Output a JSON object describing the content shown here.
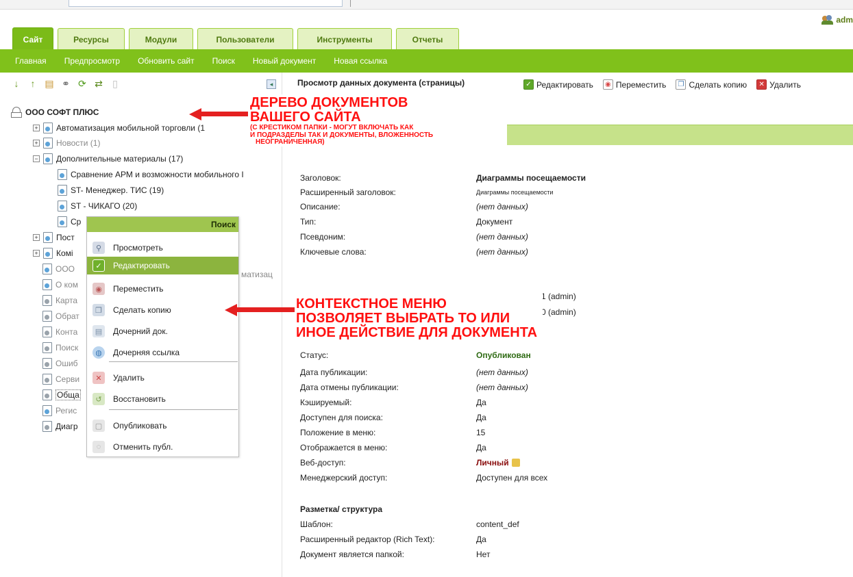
{
  "header": {
    "user_name": "adm"
  },
  "tabs": [
    {
      "label": "Сайт",
      "active": true
    },
    {
      "label": "Ресурсы",
      "active": false
    },
    {
      "label": "Модули",
      "active": false
    },
    {
      "label": "Пользователи",
      "active": false
    },
    {
      "label": "Инструменты",
      "active": false
    },
    {
      "label": "Отчеты",
      "active": false
    }
  ],
  "subnav": [
    "Главная",
    "Предпросмотр",
    "Обновить сайт",
    "Поиск",
    "Новый документ",
    "Новая ссылка"
  ],
  "tree": {
    "root": "ООО СОФТ ПЛЮС",
    "items": [
      {
        "label": "Автоматизация мобильной торговли (1",
        "toggle": "+"
      },
      {
        "label": "Новости (1)",
        "toggle": "+"
      },
      {
        "label": "Дополнительные материалы (17)",
        "toggle": "−"
      },
      {
        "label": "Сравнение АРМ и возможности мобильного I"
      },
      {
        "label": "ST- Менеджер. ТИС (19)"
      },
      {
        "label": "ST - ЧИКАГО (20)"
      },
      {
        "label": "Ср"
      },
      {
        "label": "Пост",
        "toggle": "+"
      },
      {
        "label": "Комі",
        "toggle": "+"
      },
      {
        "label": "ООО"
      },
      {
        "label": "О ком"
      },
      {
        "label": "Карта"
      },
      {
        "label": "Обрат"
      },
      {
        "label": "Конта"
      },
      {
        "label": "Поиск"
      },
      {
        "label": "Ошиб"
      },
      {
        "label": "Серви"
      },
      {
        "label": "Обща"
      },
      {
        "label": "Регис"
      },
      {
        "label": "Диагр"
      }
    ],
    "partial_text": "матизац"
  },
  "context_menu": {
    "header": "Поиск",
    "items": [
      {
        "label": "Просмотреть",
        "icon": "magnifier-icon",
        "color": "#d5dbe6"
      },
      {
        "label": "Редактировать",
        "icon": "check-icon",
        "color": "#6fb02a"
      },
      {
        "label": "Переместить",
        "icon": "move-icon",
        "color": "#e5c7c7"
      },
      {
        "label": "Сделать копию",
        "icon": "copy-icon",
        "color": "#d3dce7"
      },
      {
        "label": "Дочерний док.",
        "icon": "child-doc-icon",
        "color": "#dfe6ee"
      },
      {
        "label": "Дочерняя ссылка",
        "icon": "globe-icon",
        "color": "#b9d4ee"
      },
      {
        "label": "Удалить",
        "icon": "delete-icon",
        "color": "#efc3c3"
      },
      {
        "label": "Восстановить",
        "icon": "restore-icon",
        "color": "#d8e8c4"
      },
      {
        "label": "Опубликовать",
        "icon": "publish-icon",
        "color": "#e6e6e6"
      },
      {
        "label": "Отменить публ.",
        "icon": "unpublish-icon",
        "color": "#e6e6e6"
      }
    ]
  },
  "content": {
    "title": "Просмотр данных документа (страницы)",
    "actions": [
      {
        "label": "Редактировать",
        "icon": "check-icon",
        "color": "#5fa82a"
      },
      {
        "label": "Переместить",
        "icon": "move-icon",
        "color": "#d84a4a"
      },
      {
        "label": "Сделать копию",
        "icon": "copy-icon",
        "color": "#4a7fb5"
      },
      {
        "label": "Удалить",
        "icon": "delete-icon",
        "color": "#d23a3a"
      }
    ],
    "fields": [
      {
        "label": "Заголовок:",
        "value": "Диаграммы посещаемости",
        "style": "bold"
      },
      {
        "label": "Расширенный заголовок:",
        "value": "Диаграммы посещаемости",
        "style": "small"
      },
      {
        "label": "Описание:",
        "value": "(нет данных)",
        "style": "ital"
      },
      {
        "label": "Тип:",
        "value": "Документ",
        "style": ""
      },
      {
        "label": "Псевдоним:",
        "value": "(нет данных)",
        "style": "ital"
      },
      {
        "label": "Ключевые слова:",
        "value": "(нет данных)",
        "style": "ital"
      }
    ],
    "partial_values": [
      {
        "value": "1 (admin)"
      },
      {
        "value": "0 (admin)"
      }
    ],
    "status_fields": [
      {
        "label": "Статус:",
        "value": "Опубликован",
        "style": "published"
      },
      {
        "label": "Дата публикации:",
        "value": "(нет данных)",
        "style": "ital"
      },
      {
        "label": "Дата отмены публикации:",
        "value": "(нет данных)",
        "style": "ital"
      },
      {
        "label": "Кэшируемый:",
        "value": "Да",
        "style": ""
      },
      {
        "label": "Доступен для поиска:",
        "value": "Да",
        "style": ""
      },
      {
        "label": "Положение в меню:",
        "value": "15",
        "style": ""
      },
      {
        "label": "Отображается в меню:",
        "value": "Да",
        "style": ""
      },
      {
        "label": "Веб-доступ:",
        "value": "Личный",
        "style": "private"
      },
      {
        "label": "Менеджерский доступ:",
        "value": "Доступен для всех",
        "style": ""
      }
    ],
    "markup_section": {
      "title": "Разметка/ структура",
      "fields": [
        {
          "label": "Шаблон:",
          "value": "content_def"
        },
        {
          "label": "Расширенный редактор (Rich Text):",
          "value": "Да"
        },
        {
          "label": "Документ является папкой:",
          "value": "Нет"
        }
      ]
    }
  },
  "annotations": {
    "tree_title_line1": "ДЕРЕВО ДОКУМЕНТОВ",
    "tree_title_line2": "ВАШЕГО САЙТА",
    "tree_note_1": "(С КРЕСТИКОМ ПАПКИ - МОГУТ ВКЛЮЧАТЬ КАК",
    "tree_note_2": "И ПОДРАЗДЕЛЫ ТАК И ДОКУМЕНТЫ, ВЛОЖЕННОСТЬ",
    "tree_note_3": "НЕОГРАНИЧЕННАЯ)",
    "menu_line1": "КОНТЕКСТНОЕ МЕНЮ",
    "menu_line2": "ПОЗВОЛЯЕТ ВЫБРАТЬ ТО ИЛИ",
    "menu_line3": "ИНОЕ ДЕЙСТВИЕ ДЛЯ ДОКУМЕНТА",
    "color": "#ff1010"
  }
}
